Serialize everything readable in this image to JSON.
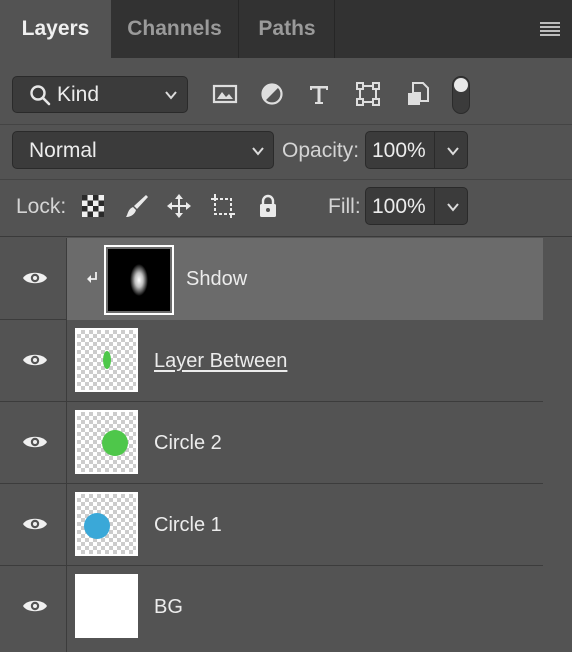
{
  "tabs": [
    {
      "label": "Layers"
    },
    {
      "label": "Channels"
    },
    {
      "label": "Paths"
    }
  ],
  "filter": {
    "kind_label": "Kind",
    "icons": [
      "image-filter-icon",
      "adjustment-filter-icon",
      "type-filter-icon",
      "shape-filter-icon",
      "smart-object-filter-icon"
    ],
    "toggle_on": true
  },
  "blend": {
    "mode": "Normal",
    "opacity_label": "Opacity:",
    "opacity_value": "100%"
  },
  "lock": {
    "label": "Lock:",
    "fill_label": "Fill:",
    "fill_value": "100%"
  },
  "layers": [
    {
      "name": "Shdow",
      "selected": true,
      "clipped": true,
      "thumb": "shadow-mask"
    },
    {
      "name": "Layer Between",
      "underlined": true,
      "thumb": "small-green-ellipse"
    },
    {
      "name": "Circle 2",
      "thumb": "green-circle"
    },
    {
      "name": "Circle 1",
      "thumb": "blue-circle"
    },
    {
      "name": "BG",
      "thumb": "white-fill"
    }
  ],
  "colors": {
    "green": "#4ec74a",
    "blue": "#3aa8d8",
    "panel": "#535353",
    "tabbar": "#323232",
    "selected_row": "#6b6b6b"
  }
}
